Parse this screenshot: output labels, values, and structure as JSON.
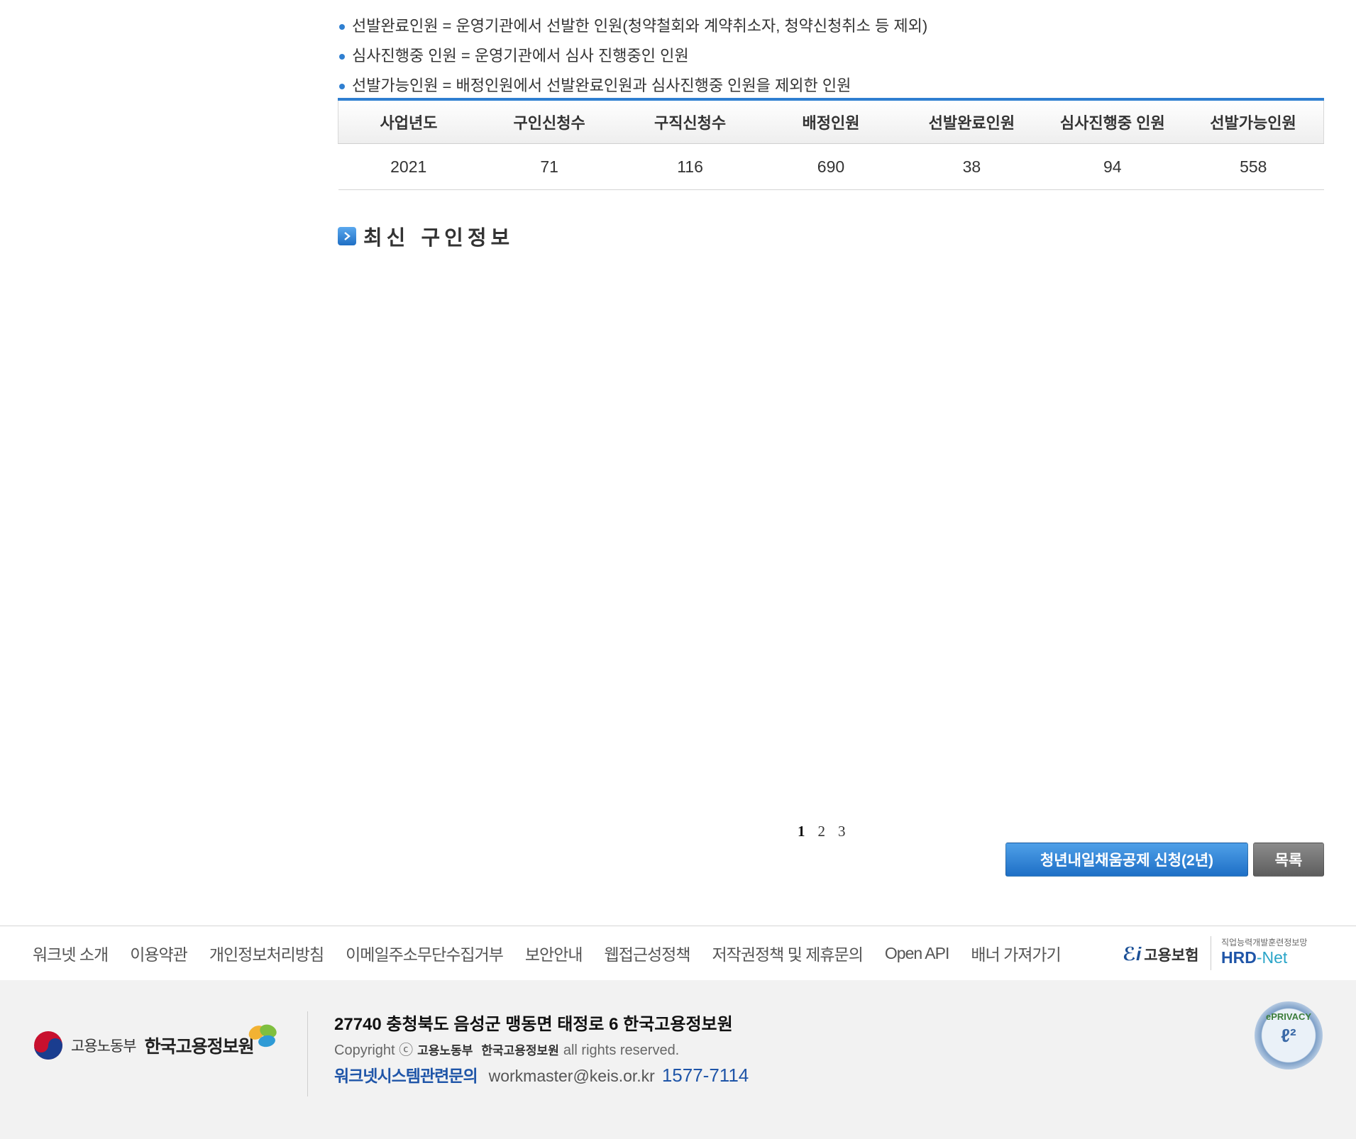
{
  "notes": [
    "선발완료인원 = 운영기관에서 선발한 인원(청약철회와 계약취소자, 청약신청취소 등 제외)",
    "심사진행중 인원 = 운영기관에서 심사 진행중인 인원",
    "선발가능인원 = 배정인원에서 선발완료인원과 심사진행중 인원을 제외한 인원"
  ],
  "stats_table": {
    "headers": [
      "사업년도",
      "구인신청수",
      "구직신청수",
      "배정인원",
      "선발완료인원",
      "심사진행중 인원",
      "선발가능인원"
    ],
    "rows": [
      [
        "2021",
        "71",
        "116",
        "690",
        "38",
        "94",
        "558"
      ]
    ]
  },
  "section": {
    "title": "최신 구인정보"
  },
  "pagination": {
    "pages": [
      "1",
      "2",
      "3"
    ],
    "current": "1"
  },
  "buttons": {
    "apply": "청년내일채움공제 신청(2년)",
    "list": "목록"
  },
  "footer": {
    "links": [
      "워크넷 소개",
      "이용약관",
      "개인정보처리방침",
      "이메일주소무단수집거부",
      "보안안내",
      "웹접근성정책",
      "저작권정책 및 제휴문의",
      "Open API",
      "배너 가져가기"
    ],
    "insurance_logo": "고용보험",
    "hrd_sub": "직업능력개발훈련정보망",
    "hrd_main": "HRD",
    "hrd_net": "-Net",
    "ministry": "고용노동부",
    "org": "한국고용정보원",
    "address": "27740 충청북도 음성군 맹동면 태정로 6 한국고용정보원",
    "copyright_prefix": "Copyright ⓒ",
    "copyright_suffix": "all rights reserved.",
    "contact_label": "워크넷시스템관련문의",
    "email": "workmaster@keis.or.kr",
    "phone": "1577-7114",
    "privacy_badge": "ePRIVACY"
  },
  "colors": {
    "accent": "#2f7fd1",
    "button_apply": "#1e6fc6",
    "button_list": "#6a6a6a",
    "footer_bg": "#f2f2f2"
  }
}
